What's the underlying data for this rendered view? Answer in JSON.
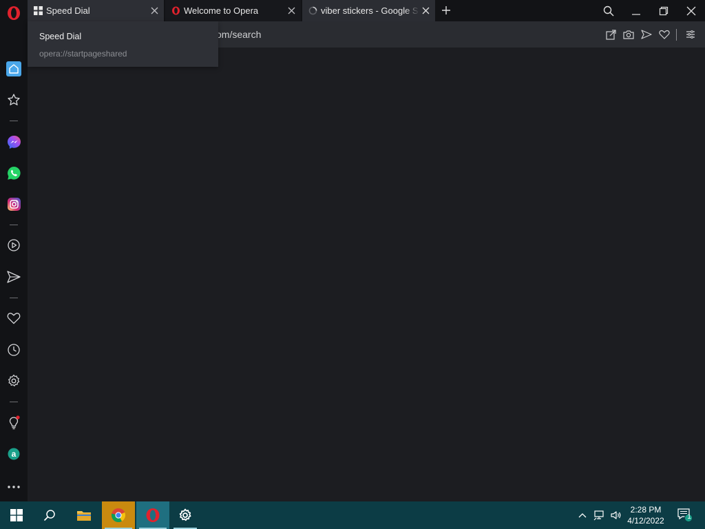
{
  "tabs": [
    {
      "title": "Speed Dial"
    },
    {
      "title": "Welcome to Opera"
    },
    {
      "title": "viber stickers - Google Search"
    }
  ],
  "address_bar": {
    "visible_text": "om/search"
  },
  "tooltip": {
    "title": "Speed Dial",
    "url": "opera://startpageshared"
  },
  "sidebar": {
    "items": [
      "home-icon",
      "bookmarks-star-icon",
      "messenger-icon",
      "whatsapp-icon",
      "instagram-icon",
      "player-icon",
      "flow-send-icon",
      "my-flow-heart-icon",
      "history-clock-icon",
      "settings-gear-icon",
      "tips-bulb-icon",
      "aliexpress-icon",
      "more-icon"
    ]
  },
  "taskbar": {
    "time": "2:28 PM",
    "date": "4/12/2022",
    "notification_count": "1"
  },
  "colors": {
    "opera_red": "#e0222d",
    "sidebar_home_accent": "#4aa7ea",
    "taskbar_bg": "#0c3c45"
  }
}
